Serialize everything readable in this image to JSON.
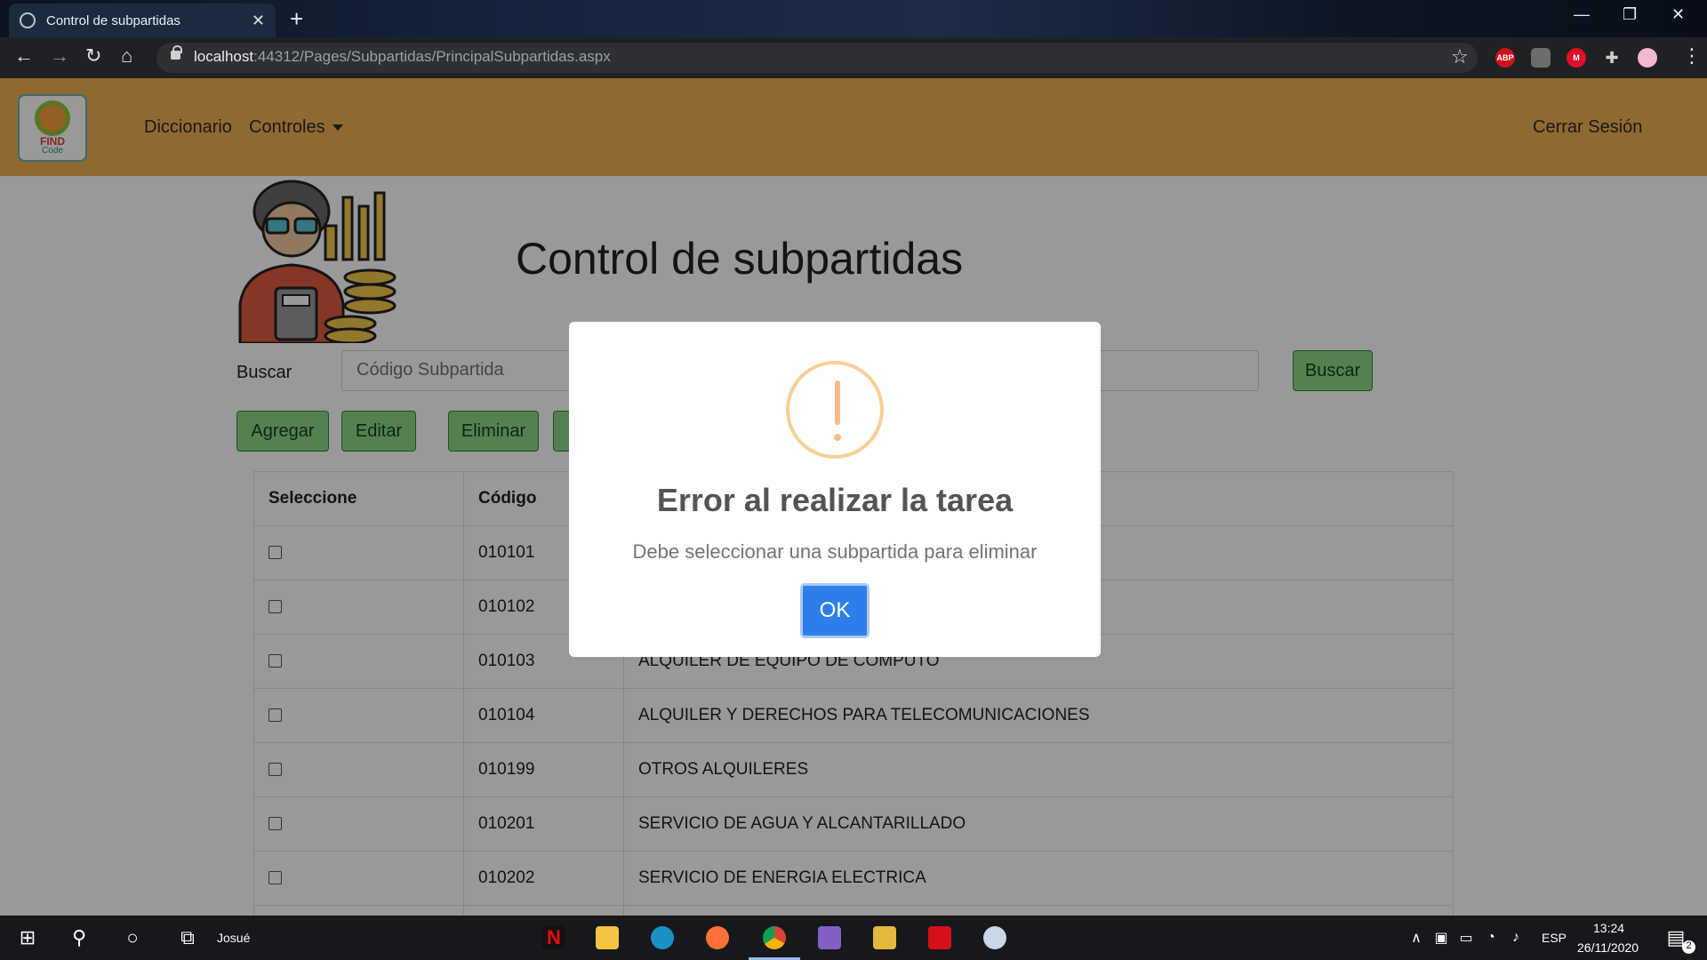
{
  "browser": {
    "tab_title": "Control de subpartidas",
    "url_host": "localhost",
    "url_rest": ":44312/Pages/Subpartidas/PrincipalSubpartidas.aspx",
    "ext_abp": "ABP",
    "ext_m": "M"
  },
  "navbar": {
    "logo_line1": "FIND",
    "logo_line2": "Code",
    "links": [
      "Diccionario",
      "Controles"
    ],
    "logout": "Cerrar Sesión"
  },
  "page": {
    "title": "Control de subpartidas",
    "search_label": "Buscar",
    "search_placeholder": "Código Subpartida",
    "search_button": "Buscar",
    "actions": [
      "Agregar",
      "Editar",
      "Eliminar"
    ]
  },
  "table": {
    "headers": [
      "Seleccione",
      "Código",
      ""
    ],
    "rows": [
      {
        "code": "010101",
        "desc": ""
      },
      {
        "code": "010102",
        "desc": ""
      },
      {
        "code": "010103",
        "desc": "ALQUILER DE EQUIPO DE COMPUTO"
      },
      {
        "code": "010104",
        "desc": "ALQUILER Y DERECHOS PARA TELECOMUNICACIONES"
      },
      {
        "code": "010199",
        "desc": "OTROS ALQUILERES"
      },
      {
        "code": "010201",
        "desc": "SERVICIO DE AGUA Y ALCANTARILLADO"
      },
      {
        "code": "010202",
        "desc": "SERVICIO DE ENERGIA ELECTRICA"
      },
      {
        "code": "",
        "desc": ""
      }
    ]
  },
  "modal": {
    "title": "Error al realizar la tarea",
    "message": "Debe seleccionar una subpartida para eliminar",
    "ok": "OK"
  },
  "taskbar": {
    "user": "Josué",
    "lang": "ESP",
    "time": "13:24",
    "date": "26/11/2020",
    "notifications": "2"
  },
  "colors": {
    "navbar": "#f0b052",
    "button_green": "#8bd889",
    "ok_blue": "#2f7fea",
    "warning": "#f8bb86"
  }
}
